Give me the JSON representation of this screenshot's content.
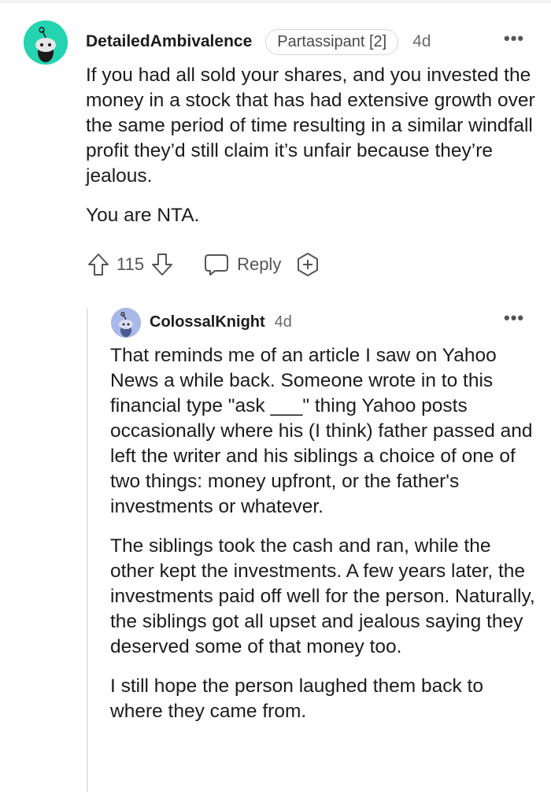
{
  "comment": {
    "username": "DetailedAmbivalence",
    "flair": "Partassipant [2]",
    "age": "4d",
    "paragraphs": [
      "If you had all sold your shares, and you invested the money in a stock that has had extensive growth over the same period of time resulting in a similar windfall profit they’d still claim it’s unfair because they’re jealous.",
      "You are NTA."
    ],
    "votes": "115",
    "reply_label": "Reply",
    "more_label": "•••"
  },
  "reply": {
    "username": "ColossalKnight",
    "age": "4d",
    "more_label": "•••",
    "paragraphs": [
      "That reminds me of an article I saw on Yahoo News a while back. Someone wrote in to this financial type \"ask ___\" thing Yahoo posts occasionally where his (I think) father passed and left the writer and his siblings a choice of one of two things: money upfront, or the father's investments or whatever.",
      "The siblings took the cash and ran, while the other kept the investments. A few years later, the investments paid off well for the person. Naturally, the siblings got all upset and jealous saying they deserved some of that money too.",
      "I still hope the person laughed them back to where they came from."
    ]
  },
  "icons": {
    "avatar1": "snoo-avatar-icon",
    "avatar2": "snoo-avatar-icon",
    "upvote": "upvote-arrow-icon",
    "downvote": "downvote-arrow-icon",
    "reply": "speech-bubble-icon",
    "award": "add-award-icon",
    "more": "more-options-icon"
  },
  "colors": {
    "avatar1_bg": "#24d3b0",
    "avatar2_bg": "#a9b8e6",
    "text": "#1c1c1c",
    "muted": "#6a6a6a"
  }
}
